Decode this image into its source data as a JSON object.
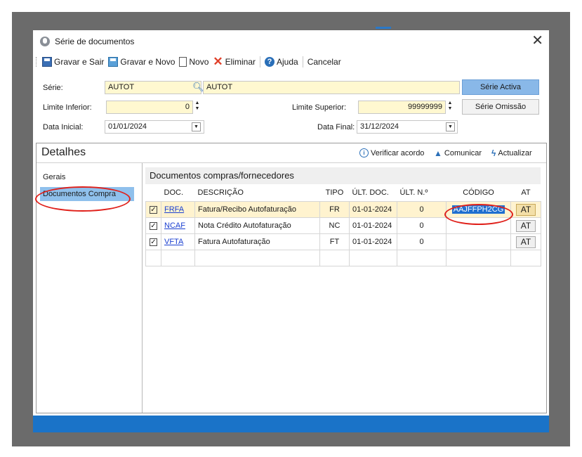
{
  "window": {
    "title": "Série de documentos",
    "close_glyph": "✕"
  },
  "toolbar": {
    "gravar_sair": "Gravar e Sair",
    "gravar_novo": "Gravar e Novo",
    "novo": "Novo",
    "eliminar": "Eliminar",
    "ajuda": "Ajuda",
    "cancelar": "Cancelar"
  },
  "form": {
    "serie_label": "Série:",
    "serie_code": "AUTOT",
    "serie_desc": "AUTOT",
    "limite_inferior_label": "Limite Inferior:",
    "limite_inferior_value": "0",
    "limite_superior_label": "Limite Superior:",
    "limite_superior_value": "99999999",
    "data_inicial_label": "Data Inicial:",
    "data_inicial_value": "01/01/2024",
    "data_final_label": "Data Final:",
    "data_final_value": "31/12/2024",
    "serie_activa_btn": "Série Activa",
    "serie_omissao_btn": "Série Omissão"
  },
  "details": {
    "title": "Detalhes",
    "verificar": "Verificar acordo",
    "comunicar": "Comunicar",
    "actualizar": "Actualizar"
  },
  "nav": {
    "items": [
      {
        "label": "Gerais"
      },
      {
        "label": "Documentos Compra"
      }
    ]
  },
  "section": {
    "title": "Documentos compras/fornecedores"
  },
  "table": {
    "headers": {
      "doc": "DOC.",
      "descricao": "DESCRIÇÃO",
      "tipo": "TIPO",
      "ult_doc": "ÚLT. DOC.",
      "ult_n": "ÚLT. N.º",
      "codigo": "CÓDIGO",
      "at": "AT"
    },
    "rows": [
      {
        "check": "☑",
        "doc": "FRFA",
        "descricao": "Fatura/Recibo Autofaturação",
        "tipo": "FR",
        "ult_doc": "01-01-2024",
        "ult_n": "0",
        "codigo": "AAJFFPH2CG",
        "at": "AT"
      },
      {
        "check": "☑",
        "doc": "NCAF",
        "descricao": "Nota Crédito Autofaturação",
        "tipo": "NC",
        "ult_doc": "01-01-2024",
        "ult_n": "0",
        "codigo": "",
        "at": "AT"
      },
      {
        "check": "☑",
        "doc": "VFTA",
        "descricao": "Fatura Autofaturação",
        "tipo": "FT",
        "ult_doc": "01-01-2024",
        "ult_n": "0",
        "codigo": "",
        "at": "AT"
      }
    ]
  },
  "colors": {
    "accent_blue": "#1a73c8",
    "field_yellow": "#fff8d0",
    "annotation_red": "#e0201a"
  }
}
